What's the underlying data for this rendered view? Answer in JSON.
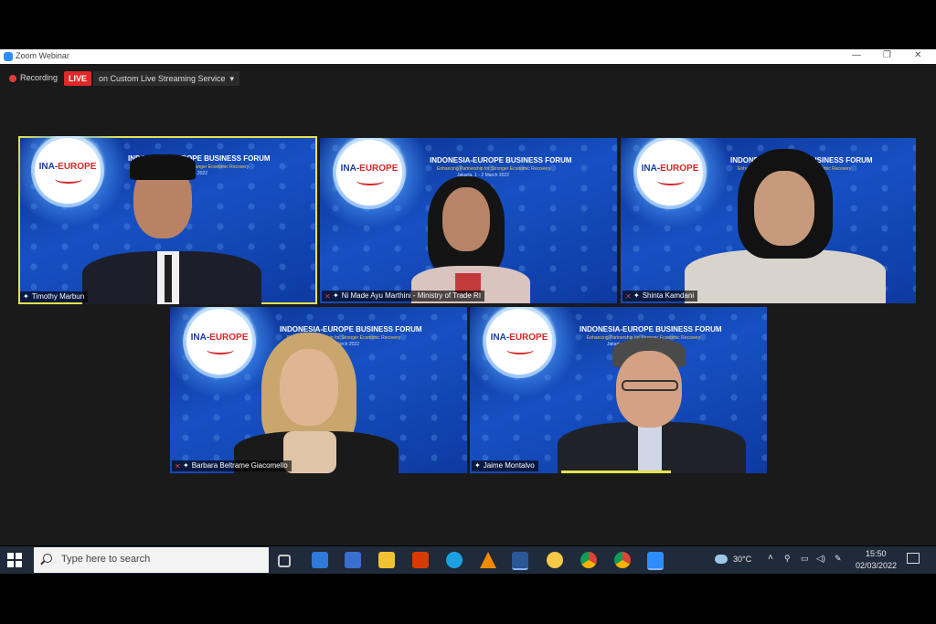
{
  "window": {
    "title": "Zoom Webinar"
  },
  "recording": {
    "label": "Recording",
    "live": "LIVE",
    "stream": "on Custom Live Streaming Service",
    "caret": "▾"
  },
  "banner": {
    "logo_text_a": "INA-",
    "logo_text_b": "EUROPE",
    "header": "INDONESIA-EUROPE BUSINESS FORUM",
    "subtitle": "Enhancing Partnership for Stronger Economic Recovery",
    "dates": "Jakarta, 1 - 2 March 2022"
  },
  "participants": [
    {
      "name": "Timothy Marbun",
      "muted": false
    },
    {
      "name": "Ni Made Ayu Marthini - Ministry of Trade RI",
      "muted": true
    },
    {
      "name": "Shinta Kamdani",
      "muted": true
    },
    {
      "name": "Barbara Beltrame Giacomello",
      "muted": true
    },
    {
      "name": "Jaime Montalvo",
      "muted": false
    }
  ],
  "taskbar": {
    "search_placeholder": "Type here to search",
    "weather": "30°C",
    "time": "15:50",
    "date": "02/03/2022"
  },
  "icons": [
    "windows-start-icon",
    "search-icon",
    "task-view-icon",
    "mail-icon",
    "store-icon",
    "file-explorer-icon",
    "office-icon",
    "edge-icon",
    "vlc-icon",
    "word-icon",
    "brave-icon",
    "chrome-icon",
    "chrome-profile-icon",
    "zoom-icon",
    "weather-icon",
    "chevron-up-icon",
    "network-icon",
    "speaker-icon",
    "notification-icon"
  ],
  "colors": {
    "active_speaker_border": "#e6e34a",
    "live_red": "#e02828",
    "banner_blue": "#1750c4"
  }
}
